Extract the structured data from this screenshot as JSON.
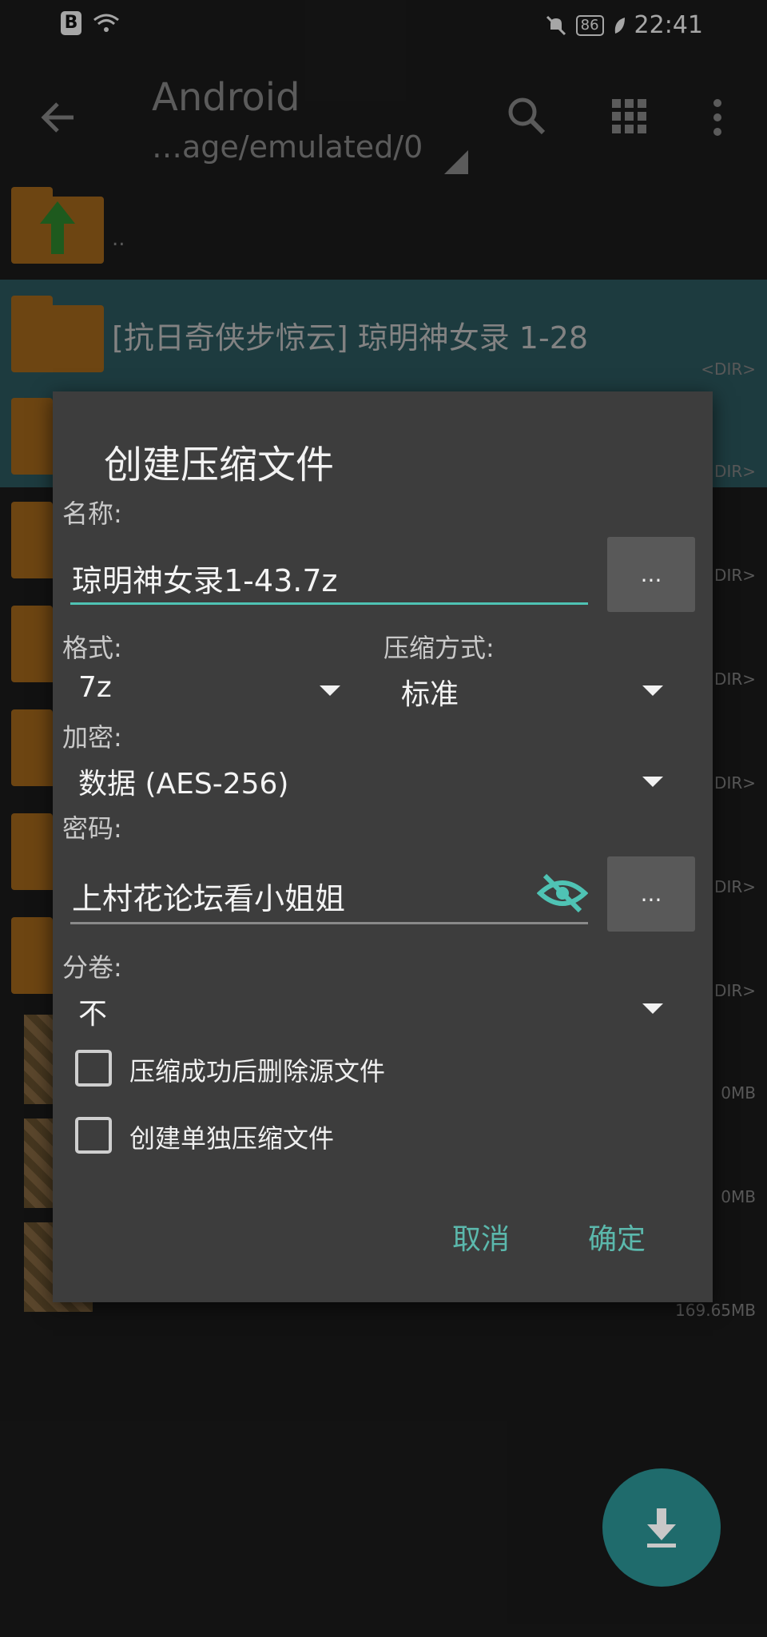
{
  "status_bar": {
    "time": "22:41",
    "battery": "86",
    "left_glyph": "B"
  },
  "app_bar": {
    "title": "Android",
    "path": "…age/emulated/0"
  },
  "file_list": {
    "parent_label": "..",
    "rows": [
      {
        "name": "[抗日奇侠步惊云] 琼明神女录 1-28",
        "meta": "<DIR>"
      },
      {
        "name": "",
        "meta": "DIR>"
      },
      {
        "name": "",
        "meta": "DIR>"
      },
      {
        "name": "",
        "meta": "DIR>"
      },
      {
        "name": "",
        "meta": "DIR>"
      },
      {
        "name": "",
        "meta": "DIR>"
      },
      {
        "name": "",
        "meta": "DIR>"
      },
      {
        "name": "",
        "meta": "0MB"
      },
      {
        "name": "",
        "meta": "0MB"
      },
      {
        "name": "",
        "meta": "169.65MB"
      }
    ]
  },
  "dialog": {
    "title": "创建压缩文件",
    "name_label": "名称:",
    "name_value": "琼明神女录1-43.7z",
    "more_label": "...",
    "format_label": "格式:",
    "format_value": "7z",
    "method_label": "压缩方式:",
    "method_value": "标准",
    "encrypt_label": "加密:",
    "encrypt_value": "数据 (AES-256)",
    "password_label": "密码:",
    "password_value": "上村花论坛看小姐姐",
    "split_label": "分卷:",
    "split_value": "不",
    "delete_source_label": "压缩成功后删除源文件",
    "delete_source_checked": false,
    "separate_archive_label": "创建单独压缩文件",
    "separate_archive_checked": false,
    "cancel_label": "取消",
    "ok_label": "确定"
  },
  "colors": {
    "accent": "#4fc3b4",
    "folder": "#a86a1c",
    "dialog_bg": "#3d3d3d",
    "selected_row": "#2d5b62"
  },
  "icons": [
    "back-arrow-icon",
    "search-icon",
    "grid-view-icon",
    "more-vert-icon",
    "folder-icon",
    "up-arrow-icon",
    "eye-off-icon",
    "download-icon",
    "wifi-icon",
    "bell-off-icon",
    "battery-icon",
    "leaf-icon"
  ]
}
